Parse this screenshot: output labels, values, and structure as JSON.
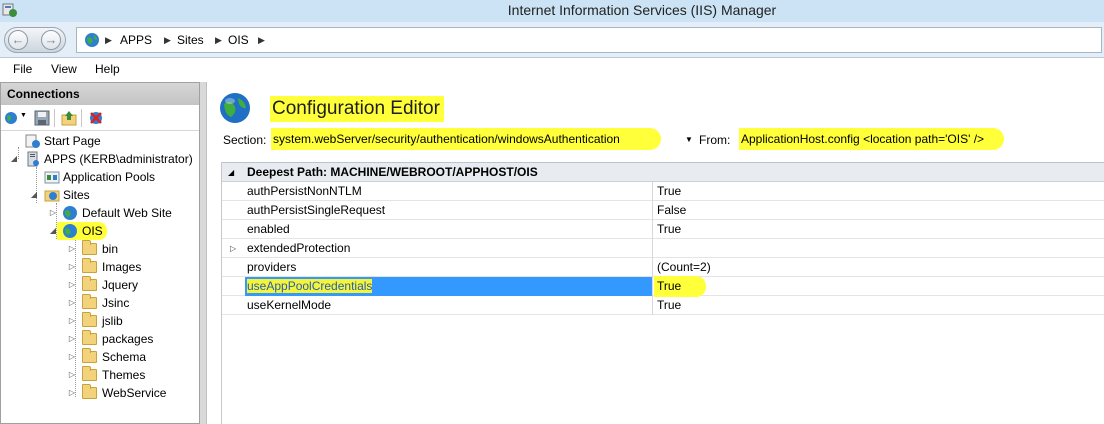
{
  "window": {
    "title": "Internet Information Services (IIS) Manager"
  },
  "address": {
    "crumbs": [
      "APPS",
      "Sites",
      "OIS"
    ]
  },
  "menu": [
    "File",
    "View",
    "Help"
  ],
  "connections": {
    "header": "Connections",
    "tree": {
      "start_page": "Start Page",
      "server": "APPS (KERB\\administrator)",
      "app_pools": "Application Pools",
      "sites": "Sites",
      "default_site": "Default Web Site",
      "ois": "OIS",
      "folders": [
        "bin",
        "Images",
        "Jquery",
        "Jsinc",
        "jslib",
        "packages",
        "Schema",
        "Themes",
        "WebService"
      ]
    }
  },
  "editor": {
    "title": "Configuration Editor",
    "section_label": "Section:",
    "section_value": "system.webServer/security/authentication/windowsAuthentication",
    "from_label": "From:",
    "from_value": "ApplicationHost.config <location path='OIS' />",
    "deepest_path": "Deepest Path: MACHINE/WEBROOT/APPHOST/OIS",
    "rows": [
      {
        "name": "authPersistNonNTLM",
        "value": "True"
      },
      {
        "name": "authPersistSingleRequest",
        "value": "False"
      },
      {
        "name": "enabled",
        "value": "True"
      },
      {
        "name": "extendedProtection",
        "value": ""
      },
      {
        "name": "providers",
        "value": "(Count=2)"
      },
      {
        "name": "useAppPoolCredentials",
        "value": "True"
      },
      {
        "name": "useKernelMode",
        "value": "True"
      }
    ]
  },
  "colors": {
    "highlight": "#ffff3a",
    "selection": "#3399ff",
    "titlebar": "#cbe3f4"
  }
}
